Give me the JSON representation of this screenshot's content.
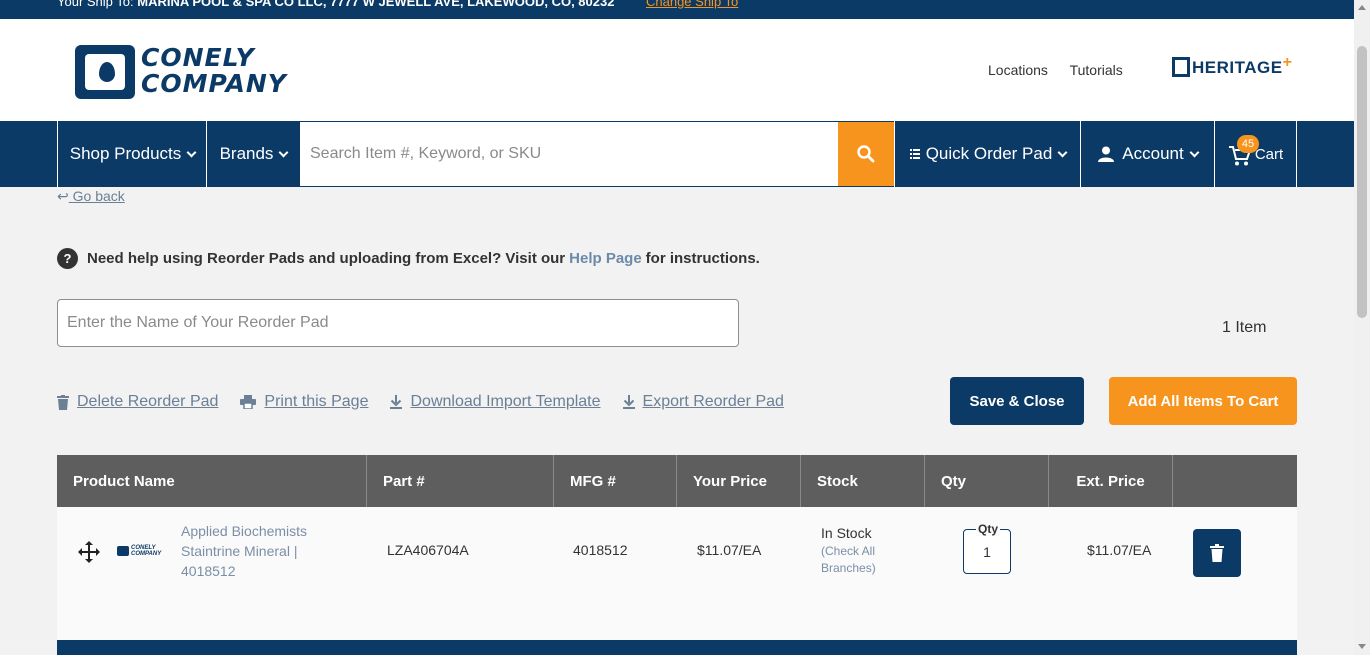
{
  "topbar": {
    "ship_to_lead": "Your Ship To: ",
    "ship_to_value": "MARINA POOL & SPA CO LLC, 7777 W JEWELL AVE, LAKEWOOD, CO, 80232",
    "change_link": "Change Ship To"
  },
  "header": {
    "logo_line1": "CONELY",
    "logo_line2": "COMPANY",
    "links": [
      "Locations",
      "Tutorials"
    ],
    "heritage_text": "HERITAGE",
    "heritage_plus": "+"
  },
  "nav": {
    "shop_products": "Shop Products",
    "brands": "Brands",
    "search_placeholder": "Search Item #, Keyword, or SKU",
    "quick_order": "Quick Order Pad",
    "account": "Account",
    "cart_label": "Cart",
    "cart_count": "45"
  },
  "page": {
    "go_back": "Go back",
    "help_prefix": "Need help using Reorder Pads and uploading from Excel? Visit our",
    "help_link": "Help Page",
    "help_suffix": "for instructions.",
    "name_placeholder": "Enter the Name of Your Reorder Pad",
    "item_count": "1 Item",
    "actions": [
      "Delete Reorder Pad",
      "Print this Page",
      "Download Import Template",
      "Export Reorder Pad"
    ],
    "save_close": "Save & Close",
    "add_all": "Add All Items To Cart"
  },
  "table": {
    "headers": [
      "Product Name",
      "Part #",
      "MFG #",
      "Your Price",
      "Stock",
      "Qty",
      "Ext. Price"
    ],
    "rows": [
      {
        "product_name": "Applied Biochemists Staintrine Mineral | 4018512",
        "brand_logo": "CONELY COMPANY",
        "part": "LZA406704A",
        "mfg": "4018512",
        "price": "$11.07/EA",
        "stock": "In Stock",
        "stock_link": "(Check All Branches)",
        "qty_label": "Qty",
        "qty": "1",
        "ext_price": "$11.07/EA"
      }
    ]
  },
  "colors": {
    "navy": "#0c3a66",
    "orange": "#f7941d",
    "table_header": "#5e5e5e"
  }
}
